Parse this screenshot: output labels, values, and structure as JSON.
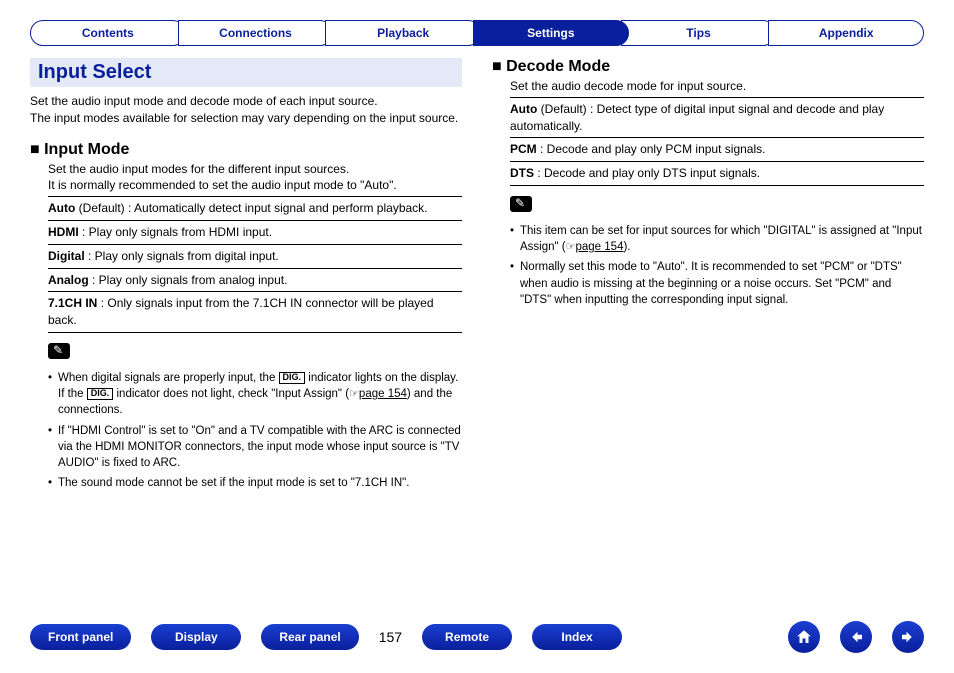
{
  "topTabs": {
    "items": [
      {
        "label": "Contents",
        "active": false
      },
      {
        "label": "Connections",
        "active": false
      },
      {
        "label": "Playback",
        "active": false
      },
      {
        "label": "Settings",
        "active": true
      },
      {
        "label": "Tips",
        "active": false
      },
      {
        "label": "Appendix",
        "active": false
      }
    ]
  },
  "left": {
    "heading": "Input Select",
    "intro": "Set the audio input mode and decode mode of each input source.\nThe input modes available for selection may vary depending on the input source.",
    "sub": "Input Mode",
    "subDesc": "Set the audio input modes for the different input sources.\nIt is normally recommended to set the audio input mode to \"Auto\".",
    "options": [
      {
        "label": "Auto",
        "suffix": " (Default)",
        "desc": " : Automatically detect input signal and perform playback."
      },
      {
        "label": "HDMI",
        "suffix": "",
        "desc": " : Play only signals from HDMI input."
      },
      {
        "label": "Digital",
        "suffix": "",
        "desc": " : Play only signals from digital input."
      },
      {
        "label": "Analog",
        "suffix": "",
        "desc": " : Play only signals from analog input."
      },
      {
        "label": "7.1CH IN",
        "suffix": "",
        "desc": " : Only signals input from the 7.1CH IN connector will be played back."
      }
    ],
    "notes": {
      "bullet1a": "When digital signals are properly input, the ",
      "bullet1b": " indicator lights on the display. If the ",
      "bullet1c": " indicator does not light, check \"Input Assign\" (",
      "bullet1_link": "page 154",
      "bullet1d": ") and the connections.",
      "dig": "DIG.",
      "bullet2": "If \"HDMI Control\" is set to \"On\" and a TV compatible with the ARC is connected via the HDMI MONITOR connectors, the input mode whose input source is \"TV AUDIO\" is fixed to ARC.",
      "bullet3": "The sound mode cannot be set if the input mode is set to \"7.1CH IN\"."
    }
  },
  "right": {
    "sub": "Decode Mode",
    "subDesc": "Set the audio decode mode for input source.",
    "options": [
      {
        "label": "Auto",
        "suffix": " (Default)",
        "desc": " : Detect type of digital input signal and decode and play automatically."
      },
      {
        "label": "PCM",
        "suffix": "",
        "desc": " : Decode and play only PCM input signals."
      },
      {
        "label": "DTS",
        "suffix": "",
        "desc": " : Decode and play only DTS input signals."
      }
    ],
    "notes": {
      "bullet1a": "This item can be set for input sources for which \"DIGITAL\" is assigned at \"Input Assign\" (",
      "bullet1_link": "page 154",
      "bullet1b": ").",
      "bullet2": "Normally set this mode to \"Auto\". It is recommended to set \"PCM\" or \"DTS\" when audio is missing at the beginning or a noise occurs. Set \"PCM\" and \"DTS\" when inputting the corresponding input signal."
    }
  },
  "bottom": {
    "frontPanel": "Front panel",
    "display": "Display",
    "rearPanel": "Rear panel",
    "pageNumber": "157",
    "remote": "Remote",
    "index": "Index"
  }
}
